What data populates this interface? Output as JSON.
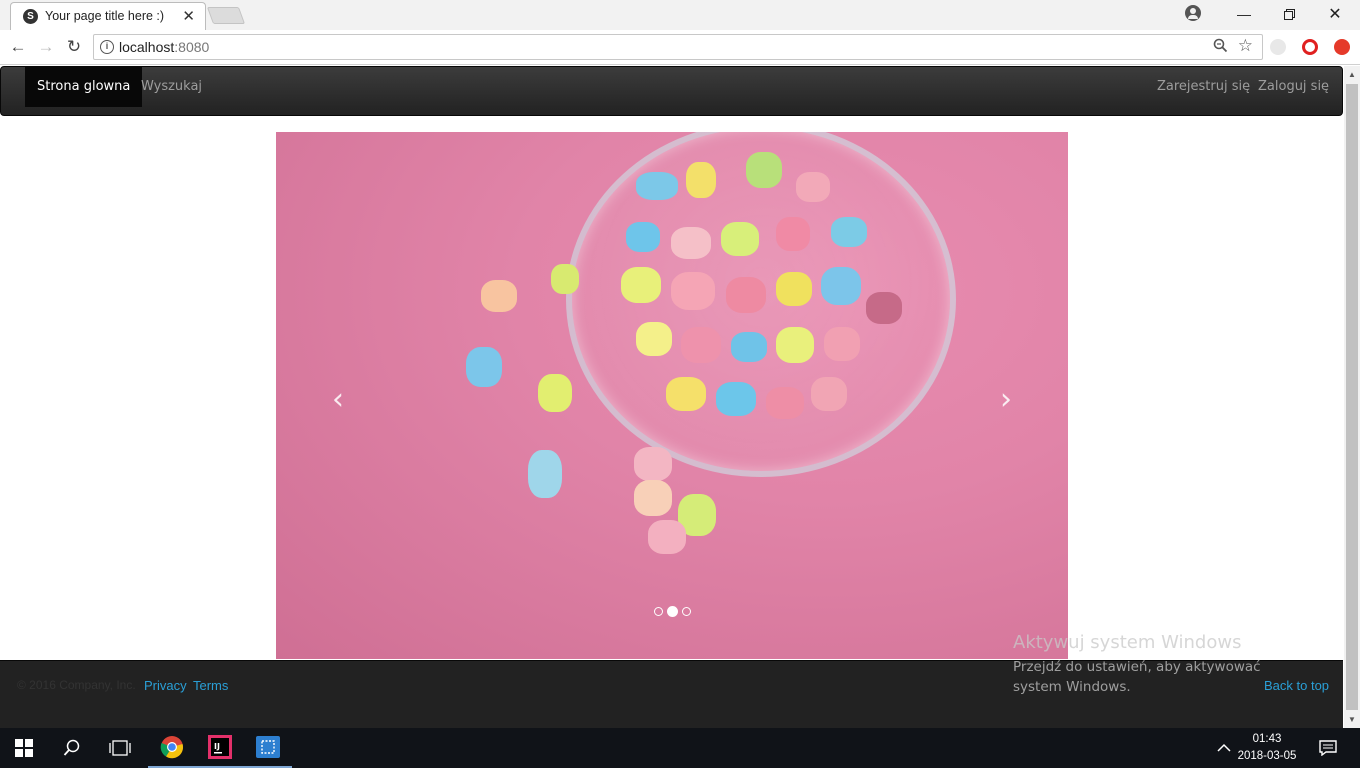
{
  "browser": {
    "tab_title": "Your page title here :)",
    "tab_favicon_letter": "S",
    "url_host": "localhost",
    "url_port": ":8080"
  },
  "navbar": {
    "items": [
      {
        "label": "Strona glowna",
        "active": true
      },
      {
        "label": "Wyszukaj",
        "active": false
      }
    ],
    "right_items": [
      {
        "label": "Zarejestruj się"
      },
      {
        "label": "Zaloguj się"
      }
    ]
  },
  "carousel": {
    "prev_label": "‹",
    "next_label": "›",
    "slide_count": 3,
    "active_index": 1
  },
  "footer": {
    "copyright": "© 2016 Company, Inc.",
    "privacy": "Privacy",
    "terms": "Terms",
    "back_to_top": "Back to top"
  },
  "activation": {
    "title": "Aktywuj system Windows",
    "subtitle": "Przejdź do ustawień, aby aktywować system Windows."
  },
  "taskbar": {
    "time": "01:43",
    "date": "2018-03-05"
  },
  "colors": {
    "link": "#2a9fd6",
    "carousel_bg": "#e184a8"
  }
}
